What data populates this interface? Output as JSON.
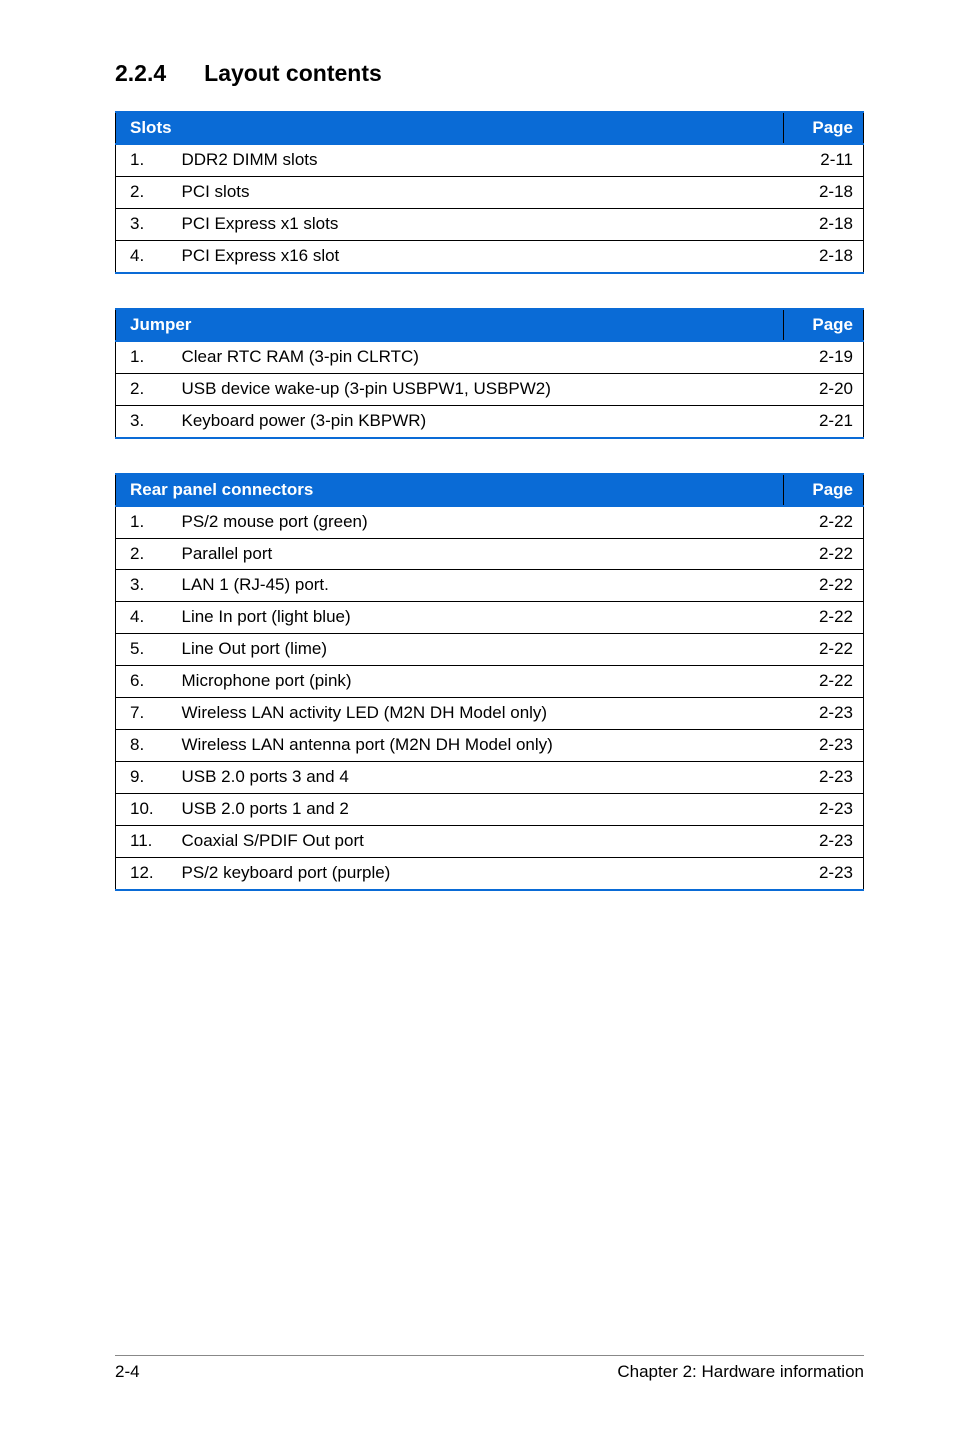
{
  "heading": {
    "number": "2.2.4",
    "title": "Layout contents"
  },
  "tables": [
    {
      "header": {
        "left": "Slots",
        "right": "Page"
      },
      "rows": [
        {
          "idx": "1.",
          "desc": "DDR2 DIMM slots",
          "pg": "2-11"
        },
        {
          "idx": "2.",
          "desc": "PCI slots",
          "pg": "2-18"
        },
        {
          "idx": "3.",
          "desc": "PCI Express x1 slots",
          "pg": "2-18"
        },
        {
          "idx": "4.",
          "desc": "PCI Express x16 slot",
          "pg": "2-18"
        }
      ]
    },
    {
      "header": {
        "left": "Jumper",
        "right": "Page"
      },
      "rows": [
        {
          "idx": "1.",
          "desc": "Clear RTC RAM (3-pin CLRTC)",
          "pg": "2-19"
        },
        {
          "idx": "2.",
          "desc": "USB device wake-up (3-pin USBPW1, USBPW2)",
          "pg": "2-20"
        },
        {
          "idx": "3.",
          "desc": "Keyboard power (3-pin KBPWR)",
          "pg": "2-21"
        }
      ]
    },
    {
      "header": {
        "left": "Rear panel connectors",
        "right": "Page"
      },
      "rows": [
        {
          "idx": "1.",
          "desc": "PS/2 mouse port (green)",
          "pg": "2-22"
        },
        {
          "idx": "2.",
          "desc": "Parallel port",
          "pg": "2-22"
        },
        {
          "idx": "3.",
          "desc": "LAN 1 (RJ-45) port.",
          "pg": "2-22"
        },
        {
          "idx": "4.",
          "desc": "Line In port (light blue)",
          "pg": "2-22"
        },
        {
          "idx": "5.",
          "desc": "Line Out port (lime)",
          "pg": "2-22"
        },
        {
          "idx": "6.",
          "desc": "Microphone port (pink)",
          "pg": "2-22"
        },
        {
          "idx": "7.",
          "desc": "Wireless LAN activity LED (M2N DH Model only)",
          "pg": "2-23"
        },
        {
          "idx": "8.",
          "desc": "Wireless LAN antenna port (M2N DH Model only)",
          "pg": "2-23"
        },
        {
          "idx": "9.",
          "desc": "USB 2.0 ports 3 and 4",
          "pg": "2-23"
        },
        {
          "idx": "10.",
          "desc": "USB 2.0 ports 1 and 2",
          "pg": "2-23"
        },
        {
          "idx": "11.",
          "desc": "Coaxial S/PDIF Out port",
          "pg": "2-23"
        },
        {
          "idx": "12.",
          "desc": "PS/2 keyboard port (purple)",
          "pg": "2-23"
        }
      ]
    }
  ],
  "footer": {
    "left": "2-4",
    "right": "Chapter 2: Hardware information"
  }
}
